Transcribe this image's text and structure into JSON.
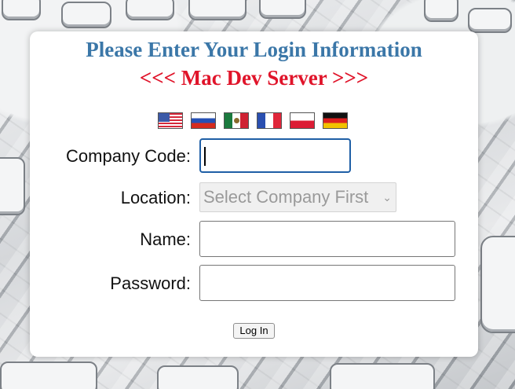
{
  "header": {
    "title": "Please Enter Your Login Information",
    "server": "<<< Mac Dev Server >>>"
  },
  "languages": [
    {
      "icon": "us-flag-icon"
    },
    {
      "icon": "russia-flag-icon"
    },
    {
      "icon": "mexico-flag-icon"
    },
    {
      "icon": "france-flag-icon"
    },
    {
      "icon": "poland-flag-icon"
    },
    {
      "icon": "germany-flag-icon"
    }
  ],
  "form": {
    "company_code_label": "Company Code:",
    "company_code_value": "",
    "location_label": "Location:",
    "location_selected": "Select Company First",
    "name_label": "Name:",
    "name_value": "",
    "password_label": "Password:",
    "password_value": "",
    "submit_label": "Log In"
  },
  "colors": {
    "title": "#3b77a8",
    "server": "#e0142a",
    "focus_border": "#1f5fa6"
  }
}
